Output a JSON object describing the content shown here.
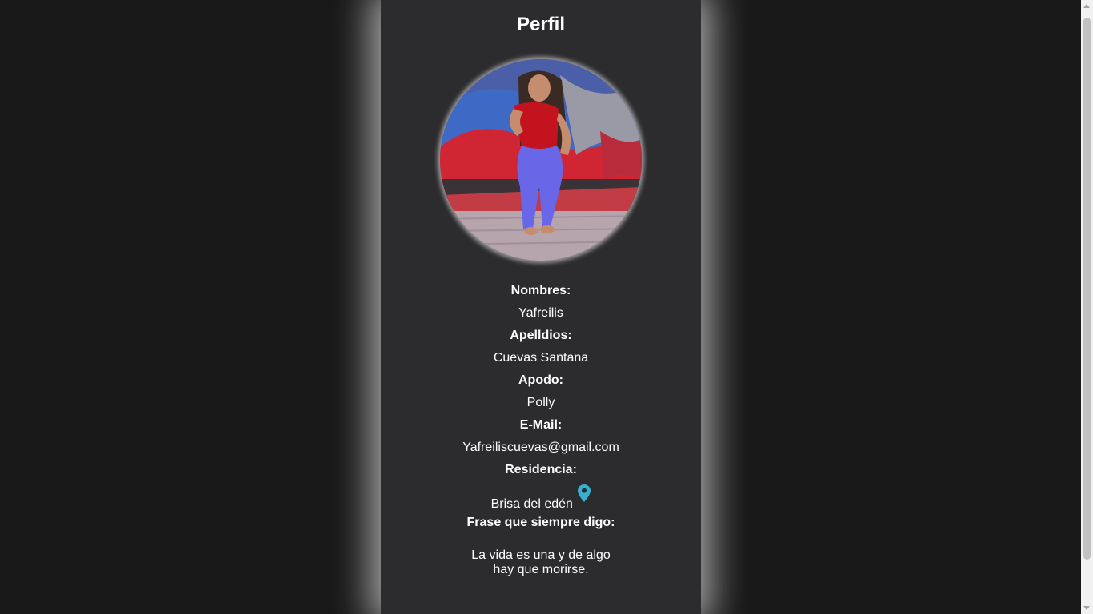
{
  "profile": {
    "title": "Perfil",
    "photo_icon": "profile-photo",
    "fields": [
      {
        "label": "Nombres:",
        "value": "Yafreilis"
      },
      {
        "label": "Apelldios:",
        "value": "Cuevas Santana"
      },
      {
        "label": "Apodo:",
        "value": "Polly"
      },
      {
        "label": "E-Mail:",
        "value": "Yafreiliscuevas@gmail.com"
      },
      {
        "label": "Residencia:",
        "value": "Brisa del edén"
      },
      {
        "label": "Frase que siempre digo:"
      }
    ],
    "phrase": "La vida es una y de algo hay que morirse.",
    "location_icon": "map-pin-icon"
  },
  "colors": {
    "background": "#181818",
    "card": "#2c2b2d",
    "text": "#ffffff",
    "pin": "#35b2cf"
  }
}
